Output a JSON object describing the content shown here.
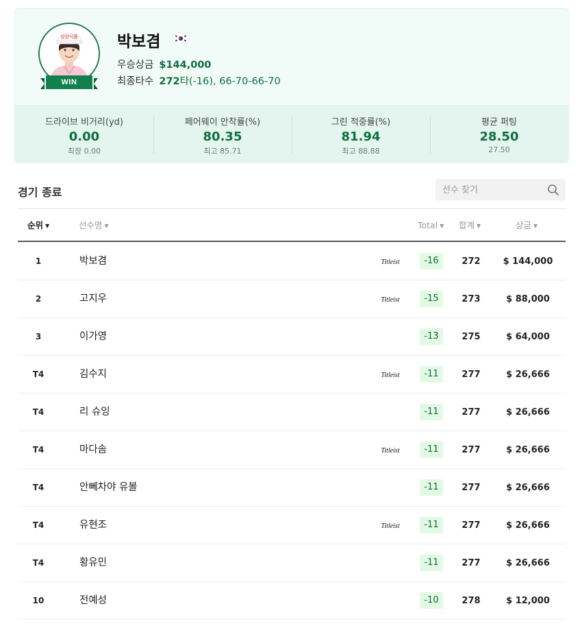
{
  "winner": {
    "name": "박보겸",
    "flag_icon": "korea-flag-icon",
    "win_badge": "WIN",
    "cap_text": "삼양식품",
    "prize_label": "우승상금",
    "prize_value": "$144,000",
    "final_label": "최종타수",
    "final_score": "272",
    "final_suffix": "타(-16),",
    "final_rounds": "66-70-66-70"
  },
  "stats": [
    {
      "label": "드라이브 비거리(yd)",
      "value": "0.00",
      "sub": "최장 0.00"
    },
    {
      "label": "페어웨이 안착률(%)",
      "value": "80.35",
      "sub": "최고 85.71"
    },
    {
      "label": "그린 적중률(%)",
      "value": "81.94",
      "sub": "최고 88.88"
    },
    {
      "label": "평균 퍼팅",
      "value": "28.50",
      "sub": "27.50"
    }
  ],
  "section": {
    "title": "경기 종료",
    "search_placeholder": "선수 찾기"
  },
  "table": {
    "headers": {
      "rank": "순위",
      "name": "선수명",
      "total": "Total",
      "sum": "합계",
      "prize": "상금"
    },
    "caret": "▼",
    "brand_label": "Titleist",
    "rows": [
      {
        "rank": "1",
        "name": "박보겸",
        "brand": true,
        "total": "-16",
        "sum": "272",
        "prize": "$ 144,000"
      },
      {
        "rank": "2",
        "name": "고지우",
        "brand": true,
        "total": "-15",
        "sum": "273",
        "prize": "$ 88,000"
      },
      {
        "rank": "3",
        "name": "이가영",
        "brand": false,
        "total": "-13",
        "sum": "275",
        "prize": "$ 64,000"
      },
      {
        "rank": "T4",
        "name": "김수지",
        "brand": true,
        "total": "-11",
        "sum": "277",
        "prize": "$ 26,666"
      },
      {
        "rank": "T4",
        "name": "리 슈잉",
        "brand": false,
        "total": "-11",
        "sum": "277",
        "prize": "$ 26,666"
      },
      {
        "rank": "T4",
        "name": "마다솜",
        "brand": true,
        "total": "-11",
        "sum": "277",
        "prize": "$ 26,666"
      },
      {
        "rank": "T4",
        "name": "안뻬차야 유볼",
        "brand": false,
        "total": "-11",
        "sum": "277",
        "prize": "$ 26,666"
      },
      {
        "rank": "T4",
        "name": "유현조",
        "brand": true,
        "total": "-11",
        "sum": "277",
        "prize": "$ 26,666"
      },
      {
        "rank": "T4",
        "name": "황유민",
        "brand": false,
        "total": "-11",
        "sum": "277",
        "prize": "$ 26,666"
      },
      {
        "rank": "10",
        "name": "전예성",
        "brand": false,
        "total": "-10",
        "sum": "278",
        "prize": "$ 12,000"
      }
    ]
  },
  "colors": {
    "accent": "#0e6e40",
    "badge_bg": "#e2f9e3",
    "card_bg": "#f1fbf7",
    "stats_bg": "#e3f5ee"
  }
}
